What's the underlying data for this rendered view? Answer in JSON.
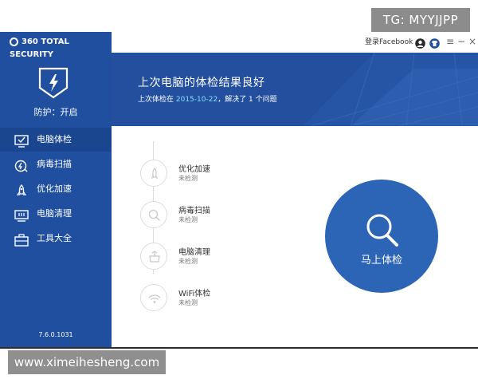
{
  "watermarks": {
    "top": "TG: MYYJJPP",
    "bottom": "www.ximeihesheng.com"
  },
  "app": {
    "logo_text": "360 TOTAL SECURITY",
    "version": "7.6.0.1031"
  },
  "sidebar": {
    "protection_status": "防护：开启",
    "items": [
      {
        "label": "电脑体检",
        "icon": "monitor-check-icon",
        "active": true
      },
      {
        "label": "病毒扫描",
        "icon": "virus-scan-icon",
        "active": false
      },
      {
        "label": "优化加速",
        "icon": "rocket-icon",
        "active": false
      },
      {
        "label": "电脑清理",
        "icon": "clean-icon",
        "active": false
      },
      {
        "label": "工具大全",
        "icon": "toolbox-icon",
        "active": false
      }
    ]
  },
  "titlebar": {
    "login_label": "登录Facebook",
    "menu": "≡",
    "minimize": "−",
    "close": "×"
  },
  "banner": {
    "title": "上次电脑的体检结果良好",
    "sub_prefix": "上次体检在 ",
    "date": "2015-10-22",
    "sub_suffix": "，解决了 1 个问题"
  },
  "checks": [
    {
      "name": "优化加速",
      "state": "未检测",
      "icon": "rocket-icon"
    },
    {
      "name": "病毒扫描",
      "state": "未检测",
      "icon": "search-icon"
    },
    {
      "name": "电脑清理",
      "state": "未检测",
      "icon": "broom-icon"
    },
    {
      "name": "WiFi体检",
      "state": "未检测",
      "icon": "wifi-icon"
    }
  ],
  "scan_button": {
    "label": "马上体检",
    "icon": "magnifier-icon"
  },
  "colors": {
    "sidebar": "#1f4f9e",
    "banner": "#244f9f",
    "accent_date": "#7fe0ff",
    "scan_button": "#2c65b5"
  }
}
